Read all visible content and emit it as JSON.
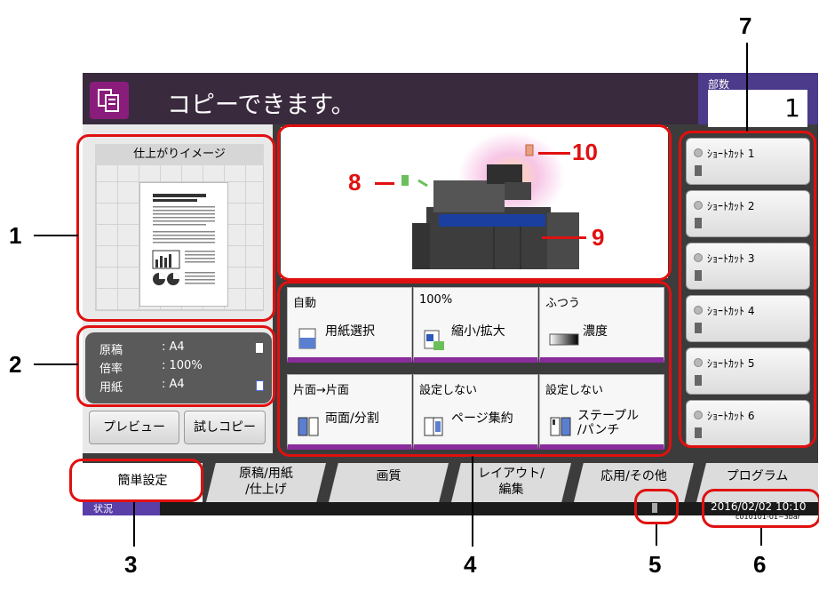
{
  "header": {
    "title": "コピーできます。",
    "copies_label": "部数",
    "copies_value": "1"
  },
  "preview": {
    "title": "仕上がりイメージ",
    "preview_button": "プレビュー",
    "trial_copy_button": "試しコピー"
  },
  "status": {
    "rows": [
      {
        "label": "原稿",
        "value": ": A4"
      },
      {
        "label": "倍率",
        "value": ": 100%"
      },
      {
        "label": "用紙",
        "value": ": A4"
      }
    ]
  },
  "functions": [
    {
      "top": "自動",
      "label": "用紙選択"
    },
    {
      "top": "100%",
      "label": "縮小/拡大"
    },
    {
      "top": "ふつう",
      "label": "濃度"
    },
    {
      "top": "片面→片面",
      "label": "両面/分割"
    },
    {
      "top": "設定しない",
      "label": "ページ集約"
    },
    {
      "top": "設定しない",
      "label": "ステープル\n/パンチ"
    }
  ],
  "shortcuts": [
    "ｼｮｰﾄｶｯﾄ 1",
    "ｼｮｰﾄｶｯﾄ 2",
    "ｼｮｰﾄｶｯﾄ 3",
    "ｼｮｰﾄｶｯﾄ 4",
    "ｼｮｰﾄｶｯﾄ 5",
    "ｼｮｰﾄｶｯﾄ 6"
  ],
  "tabs": [
    "簡単設定",
    "原稿/用紙\n/仕上げ",
    "画質",
    "レイアウト/\n編集",
    "応用/その他",
    "プログラム"
  ],
  "bottom": {
    "status_tab": "状況",
    "datetime": "2016/02/02  10:10",
    "code": "c010101-01~3bar"
  },
  "callouts": [
    "1",
    "2",
    "3",
    "4",
    "5",
    "6",
    "7",
    "8",
    "9",
    "10"
  ],
  "colors": {
    "accent": "#8a2c9c",
    "callout": "#e01010",
    "header_bg": "#3a2a3e",
    "copies_bg": "#4c3a8a"
  }
}
